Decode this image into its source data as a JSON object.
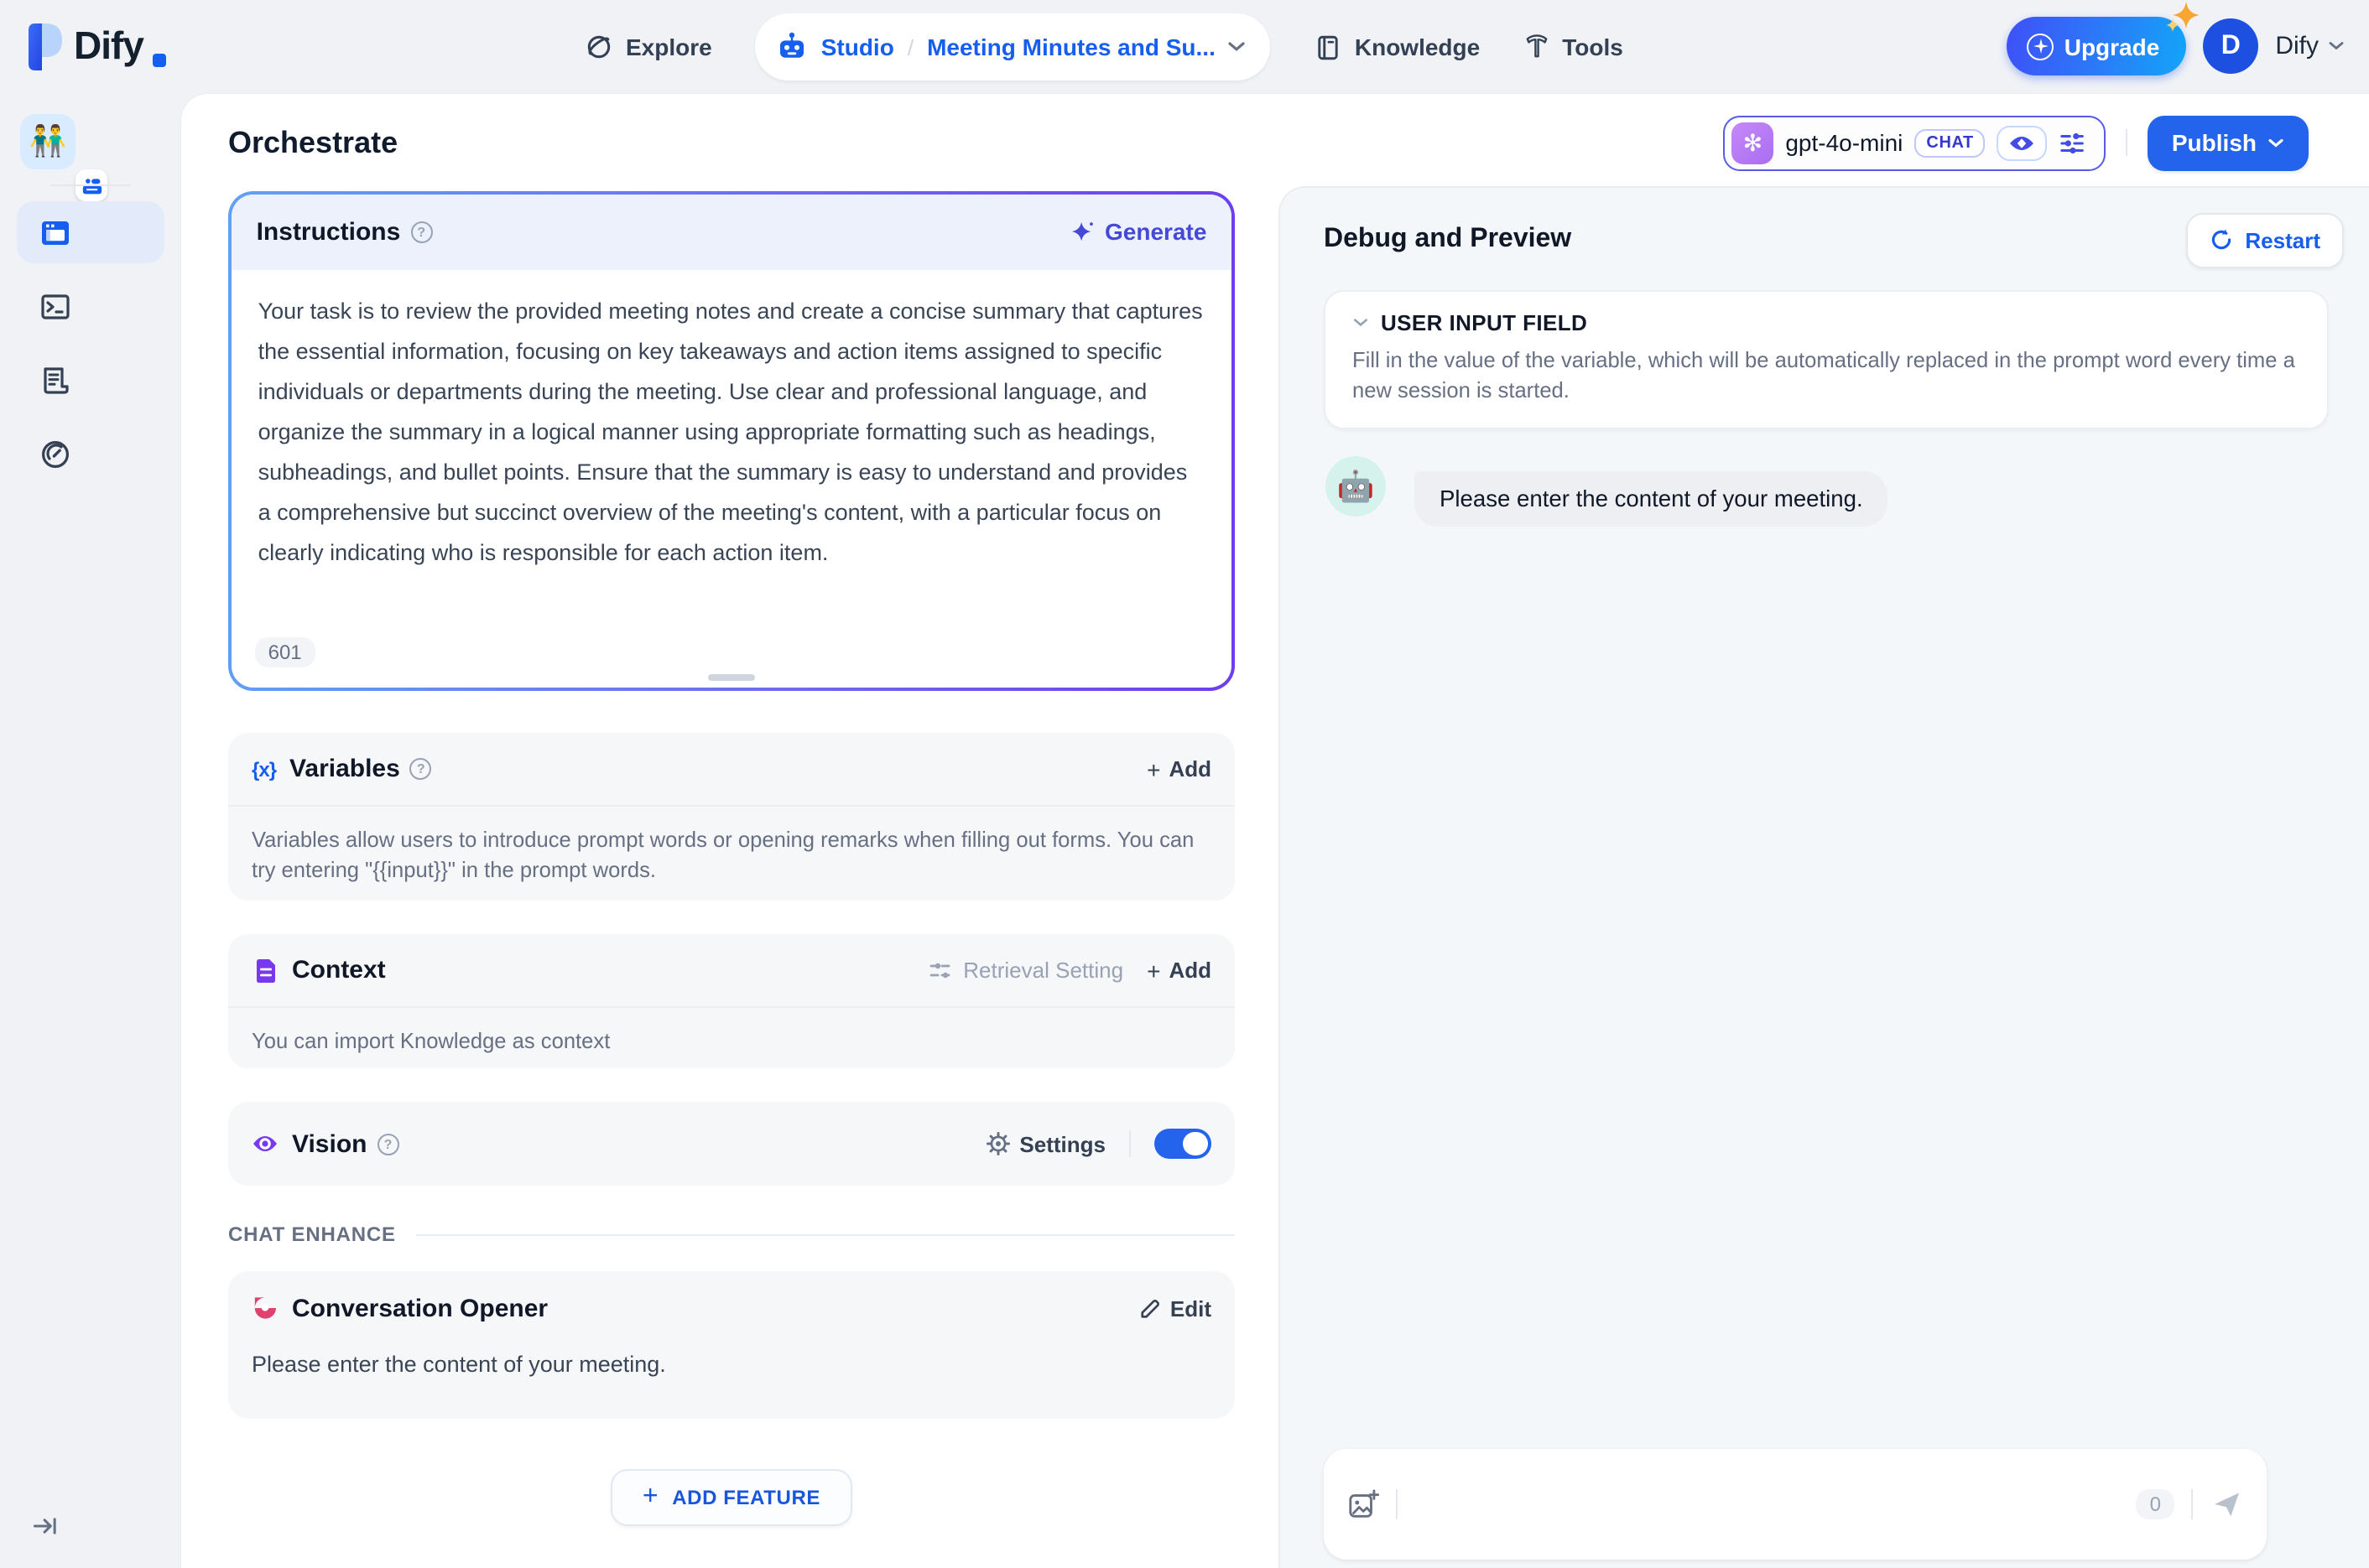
{
  "navbar": {
    "logo_text": "Dify",
    "explore_label": "Explore",
    "studio_label": "Studio",
    "separator": "/",
    "app_name": "Meeting Minutes and Su...",
    "knowledge_label": "Knowledge",
    "tools_label": "Tools",
    "upgrade_label": "Upgrade",
    "avatar_initial": "D",
    "account_name": "Dify"
  },
  "header": {
    "title": "Orchestrate",
    "model_name": "gpt-4o-mini",
    "model_mode": "CHAT",
    "publish_label": "Publish"
  },
  "config": {
    "instructions": {
      "title": "Instructions",
      "generate_label": "Generate",
      "text": "Your task is to review the provided meeting notes and create a concise summary that captures the essential information, focusing on key takeaways and action items assigned to specific individuals or departments during the meeting. Use clear and professional language, and organize the summary in a logical manner using appropriate formatting such as headings, subheadings, and bullet points. Ensure that the summary is easy to understand and provides a comprehensive but succinct overview of the meeting's content, with a particular focus on clearly indicating who is responsible for each action item.",
      "char_count": "601"
    },
    "variables": {
      "title": "Variables",
      "icon_glyph": "{x}",
      "add_label": "Add",
      "description": "Variables allow users to introduce prompt words or opening remarks when filling out forms. You can try entering \"{{input}}\" in the prompt words."
    },
    "context": {
      "title": "Context",
      "retrieval_label": "Retrieval Setting",
      "add_label": "Add",
      "description": "You can import Knowledge as context"
    },
    "vision": {
      "title": "Vision",
      "settings_label": "Settings",
      "enabled": true
    },
    "chat_enhance_label": "CHAT ENHANCE",
    "opener": {
      "title": "Conversation Opener",
      "edit_label": "Edit",
      "message": "Please enter the content of your meeting."
    },
    "add_feature_label": "ADD FEATURE"
  },
  "debug": {
    "title": "Debug and Preview",
    "restart_label": "Restart",
    "user_input": {
      "title": "USER INPUT FIELD",
      "description": "Fill in the value of the variable, which will be automatically replaced in the prompt word every time a new session is started."
    },
    "bot_message": "Please enter the content of your meeting.",
    "char_count": "0"
  },
  "icons": {
    "app_emoji": "👬",
    "bot_emoji": "🤖",
    "help_glyph": "?",
    "plus_glyph": "+",
    "openai_glyph": "✻"
  },
  "colors": {
    "primary_blue": "#155eef",
    "publish_blue": "#2463eb",
    "indigo_accent": "#4549d6",
    "purple_icon": "#7839ee",
    "pink_icon": "#e0426f",
    "panel_gray": "#f4f7f9",
    "card_gray": "#f5f7f9",
    "body_bg": "#f0f2f6"
  }
}
